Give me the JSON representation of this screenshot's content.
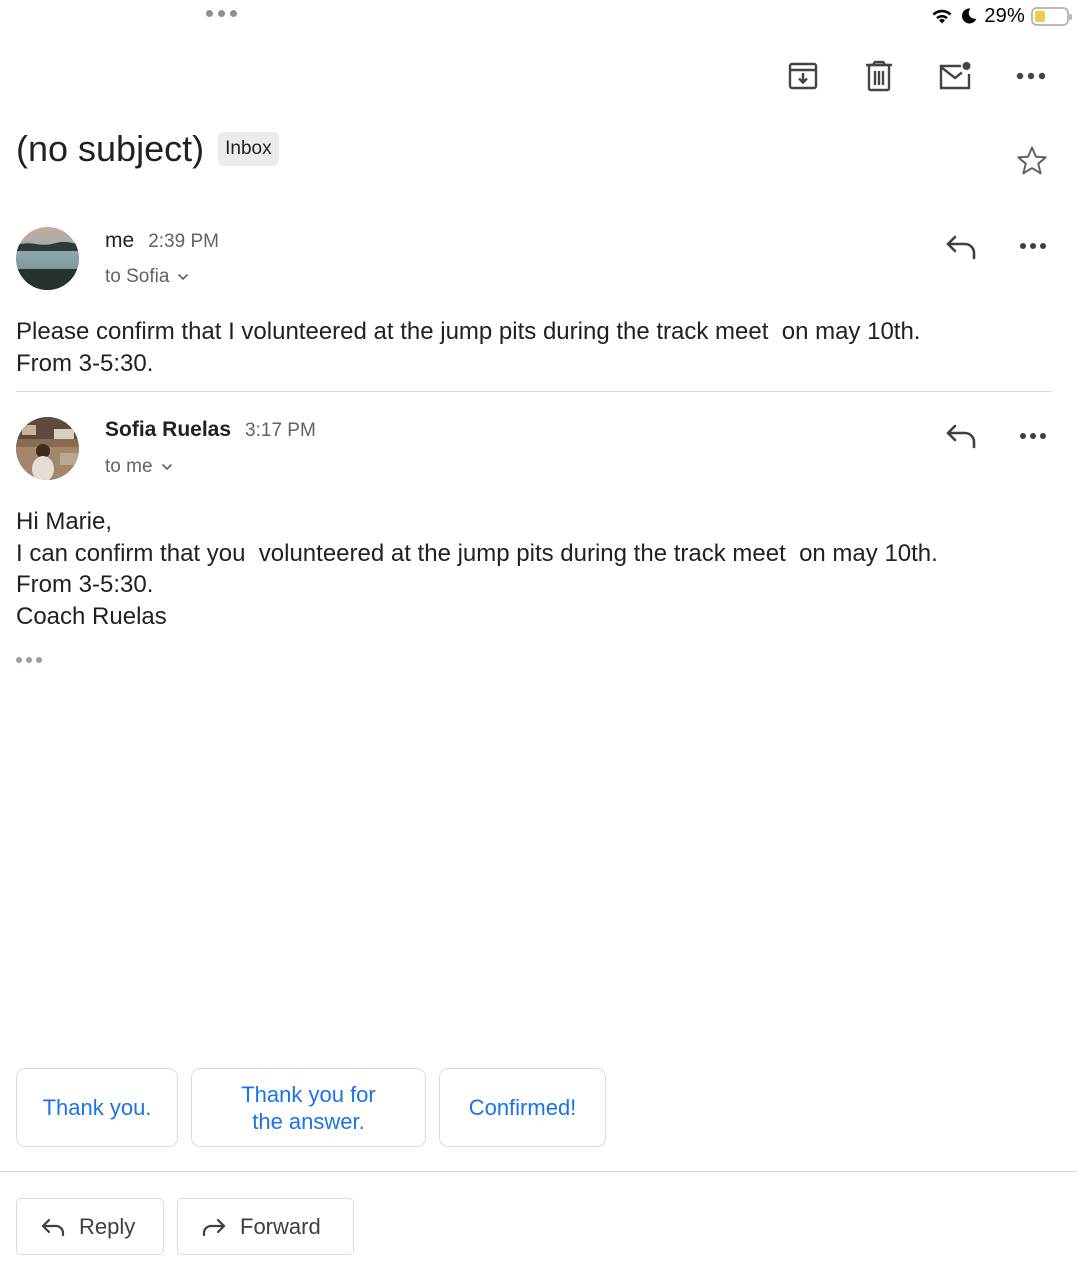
{
  "status_bar": {
    "battery_percent": "29%",
    "battery_level": 0.29,
    "icons": [
      "wifi-icon",
      "moon-icon",
      "battery-icon"
    ]
  },
  "toolbar": {
    "icons": [
      "archive-icon",
      "trash-icon",
      "mark-unread-icon",
      "more-icon"
    ]
  },
  "thread": {
    "subject": "(no subject)",
    "label": "Inbox"
  },
  "messages": [
    {
      "sender": "me",
      "time": "2:39 PM",
      "recipient": "to Sofia",
      "body": [
        "Please confirm that I volunteered at the jump pits during the track meet  on may 10th.",
        "From 3-5:30."
      ]
    },
    {
      "sender": "Sofia Ruelas",
      "time": "3:17 PM",
      "recipient": "to me",
      "body": [
        "Hi Marie,",
        "I can confirm that you  volunteered at the jump pits during the track meet  on may 10th.",
        "From 3-5:30.",
        "Coach Ruelas"
      ]
    }
  ],
  "smart_replies": [
    {
      "line1": "Thank you.",
      "line2": ""
    },
    {
      "line1": "Thank you for",
      "line2": "the answer."
    },
    {
      "line1": "Confirmed!",
      "line2": ""
    }
  ],
  "actions": {
    "reply_label": "Reply",
    "forward_label": "Forward"
  },
  "colors": {
    "accent": "#1a73e8",
    "text": "#202124",
    "secondary_text": "#5f6368",
    "border": "#dadce0",
    "battery": "#f2c94c"
  }
}
